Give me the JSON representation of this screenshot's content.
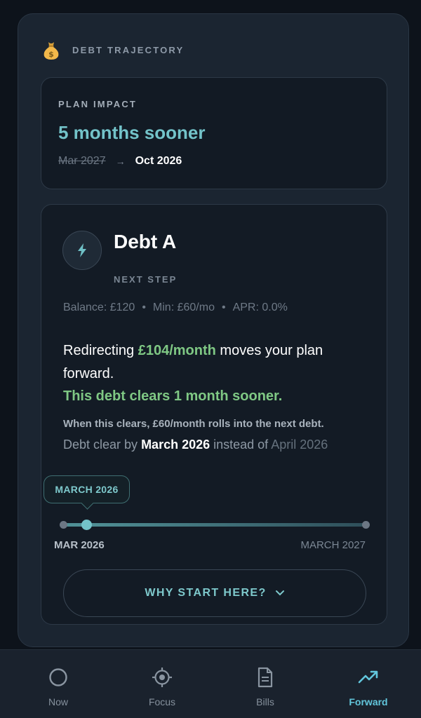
{
  "header": {
    "icon": "money-bag-icon",
    "label": "DEBT TRAJECTORY"
  },
  "impact": {
    "label": "PLAN IMPACT",
    "value": "5 months sooner",
    "old_date": "Mar 2027",
    "new_date": "Oct 2026"
  },
  "debt": {
    "icon": "lightning-bolt-icon",
    "name": "Debt A",
    "tag": "NEXT STEP",
    "balance": "Balance: £120",
    "min": "Min: £60/mo",
    "apr": "APR: 0.0%",
    "redirect_prefix": "Redirecting ",
    "redirect_amount": "£104/month",
    "redirect_suffix": " moves your plan forward.",
    "clears_text": "This debt clears 1 month sooner.",
    "rolls_text": "When this clears, £60/month rolls into the next debt.",
    "clear_by_prefix": "Debt clear by ",
    "clear_by_date": "March 2026",
    "clear_by_middle": " instead of ",
    "clear_by_old": "April 2026"
  },
  "slider": {
    "tooltip": "MARCH 2026",
    "start_label": "MAR 2026",
    "end_label": "MARCH 2027",
    "position_fraction": 0.077
  },
  "why_button": {
    "label": "WHY START HERE?",
    "icon": "chevron-down-icon"
  },
  "tabs": [
    {
      "label": "Now",
      "icon": "circle-icon",
      "active": false
    },
    {
      "label": "Focus",
      "icon": "target-icon",
      "active": false
    },
    {
      "label": "Bills",
      "icon": "document-icon",
      "active": false
    },
    {
      "label": "Forward",
      "icon": "trending-up-icon",
      "active": true
    }
  ],
  "colors": {
    "accent_teal": "#73c3c9",
    "accent_green": "#7fc884",
    "active_tab": "#62c6dc",
    "background": "#0d131b"
  }
}
